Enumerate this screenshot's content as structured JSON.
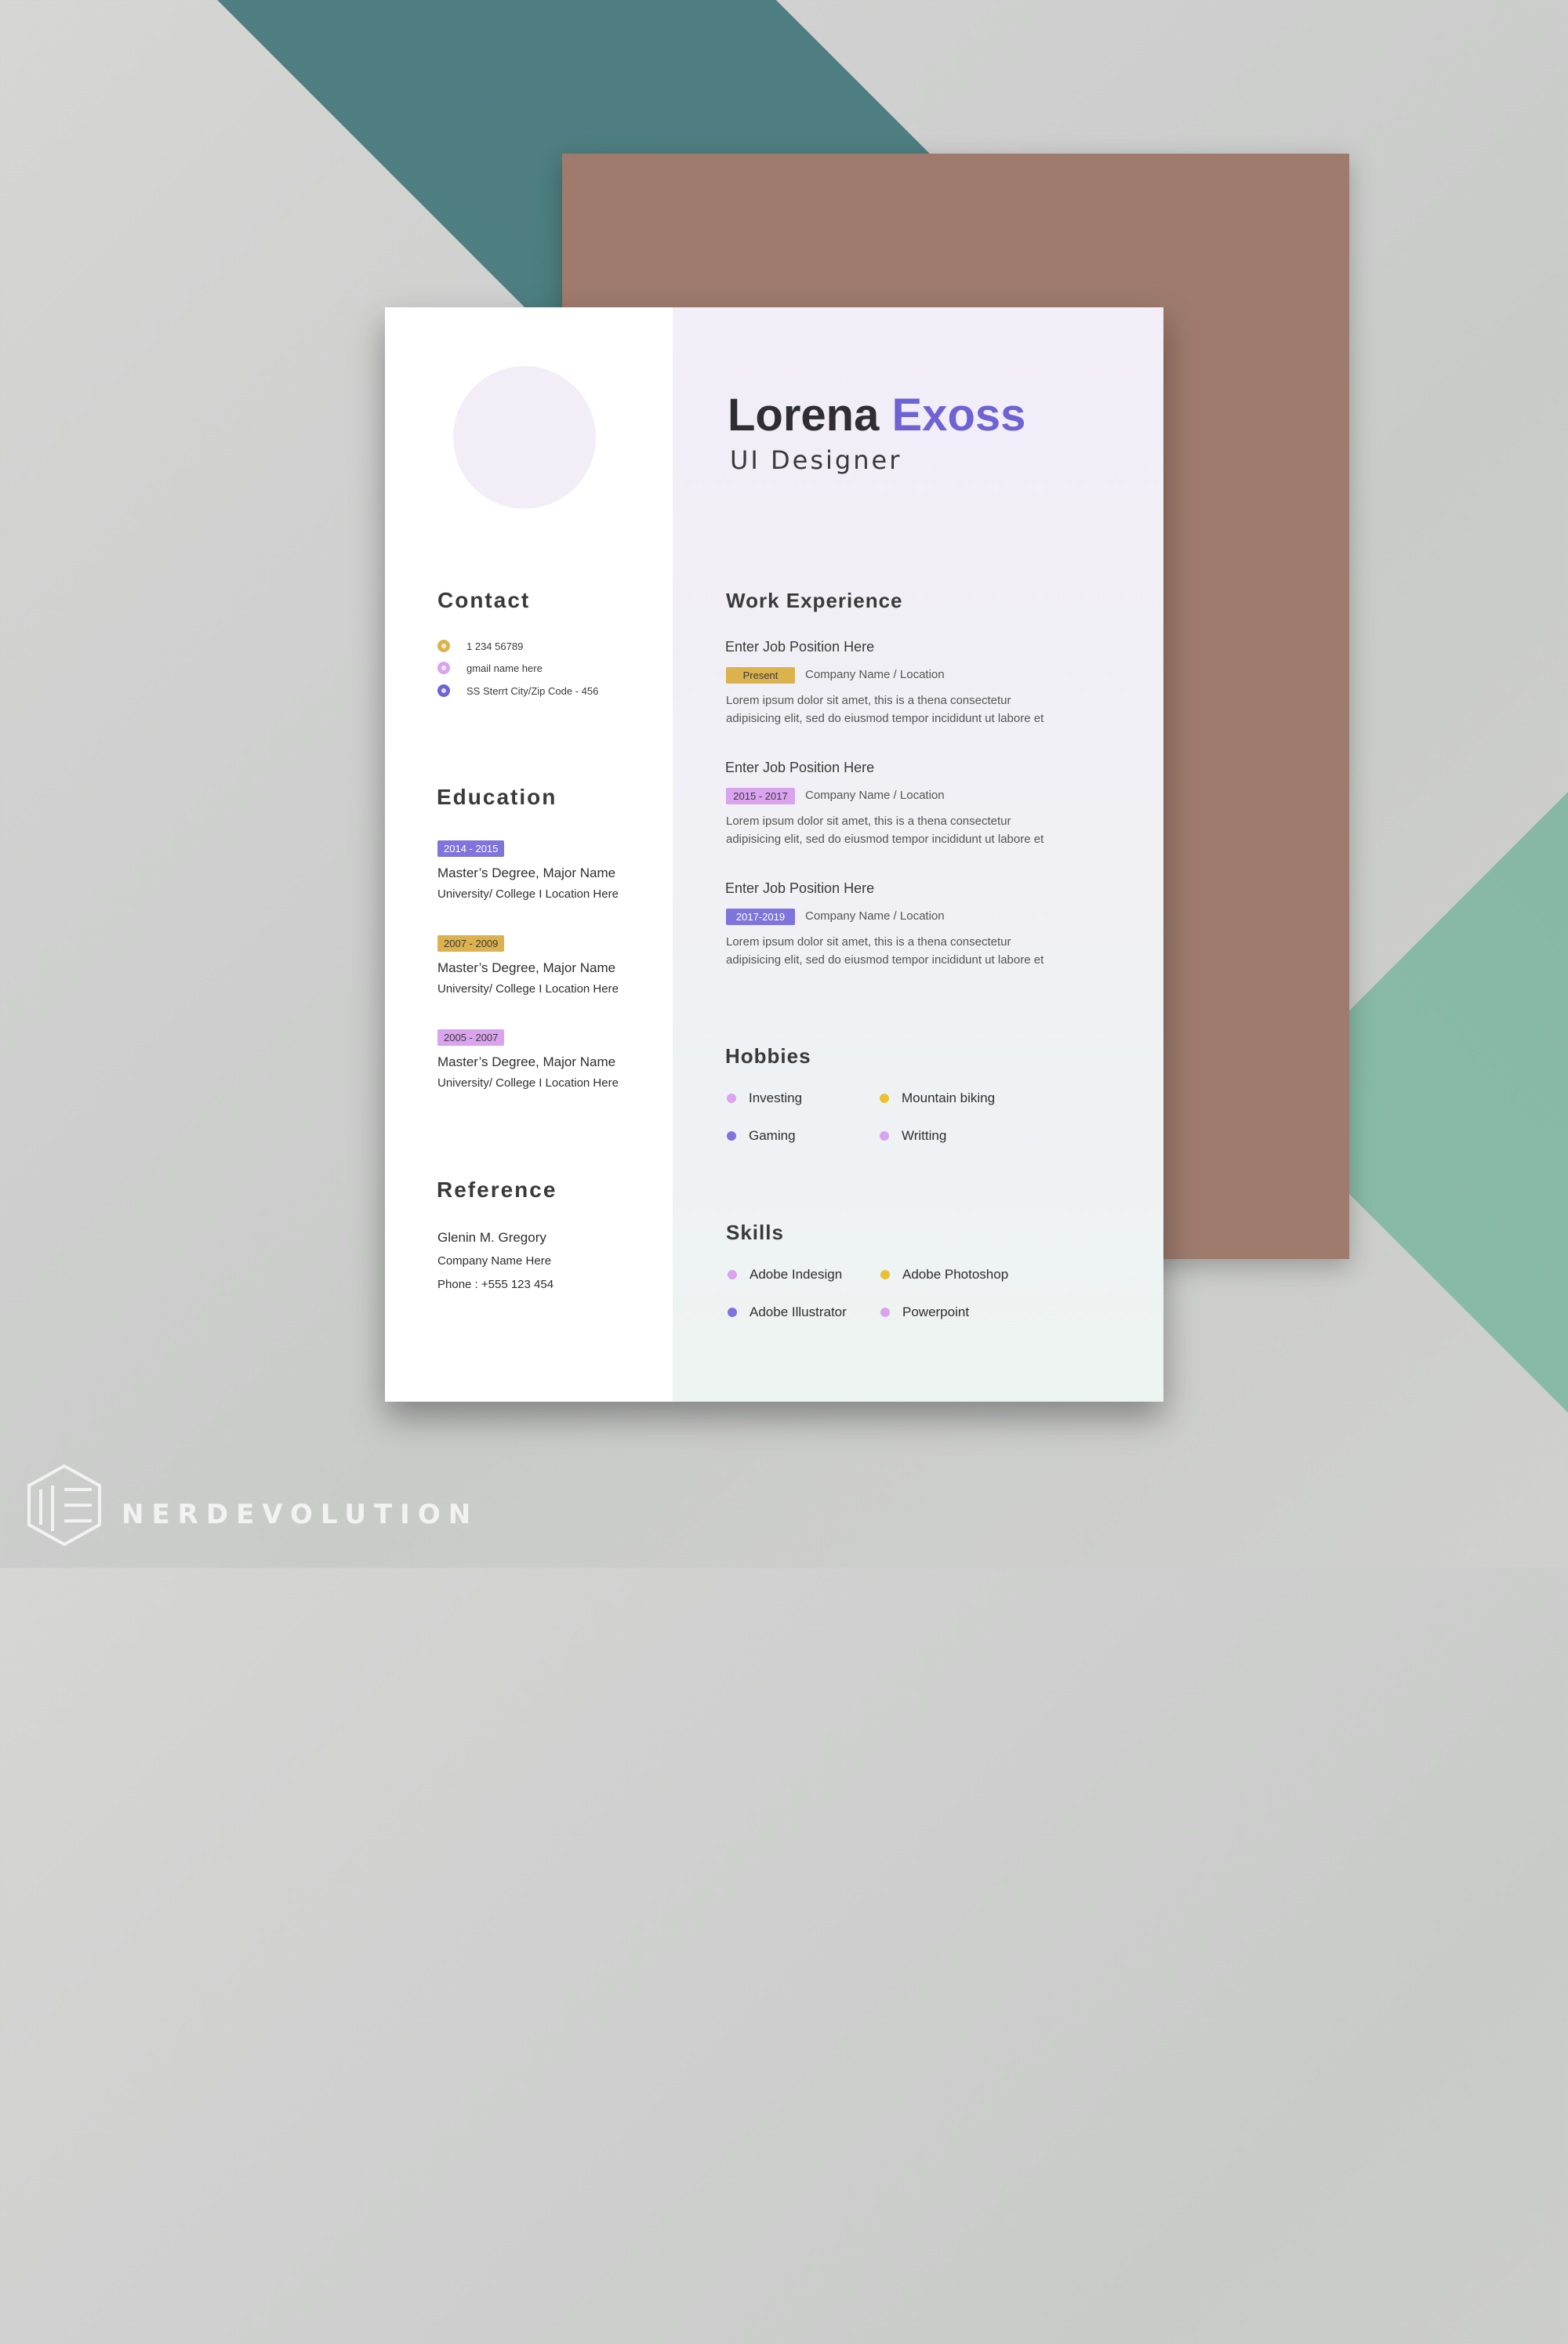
{
  "colors": {
    "accent_purple": "#6e62d4",
    "accent_gold": "#dcb24e",
    "accent_pink": "#d9a3ee",
    "brown_sheet": "#9e7b6d",
    "teal": "#4e7d82"
  },
  "header": {
    "first_name": "Lorena",
    "last_name": "Exoss",
    "role": "UI Designer"
  },
  "contact": {
    "title": "Contact",
    "items": [
      {
        "icon": "phone-icon",
        "text": "1 234 56789",
        "color": "#dcb24e"
      },
      {
        "icon": "mail-icon",
        "text": "gmail name here",
        "color": "#d9a3ee"
      },
      {
        "icon": "location-pin-icon",
        "text": "SS Sterrt City/Zip Code - 456",
        "color": "#6e62d4"
      }
    ]
  },
  "education": {
    "title": "Education",
    "items": [
      {
        "years": "2014 - 2015",
        "badge_color": "#7f74db",
        "degree": "Master’s Degree, Major Name",
        "school": "University/ College I Location Here"
      },
      {
        "years": "2007 - 2009",
        "badge_color": "#dcb24e",
        "degree": "Master’s Degree, Major Name",
        "school": "University/ College I Location Here"
      },
      {
        "years": "2005 - 2007",
        "badge_color": "#d9a3ee",
        "degree": "Master’s Degree, Major Name",
        "school": "University/ College I Location Here"
      }
    ]
  },
  "reference": {
    "title": "Reference",
    "name": "Glenin M. Gregory",
    "company": "Company Name Here",
    "phone": "Phone : +555 123 454"
  },
  "work": {
    "title": "Work Experience",
    "jobs": [
      {
        "position": "Enter Job Position Here",
        "period": "Present",
        "badge_color": "#dcb24e",
        "company": "Company Name / Location",
        "desc_1": "Lorem ipsum dolor sit amet, this is a thena  consectetur",
        "desc_2": "adipisicing elit, sed do eiusmod tempor incididunt ut labore et"
      },
      {
        "position": "Enter Job Position Here",
        "period": "2015 - 2017",
        "badge_color": "#d9a3ee",
        "company": "Company Name / Location",
        "desc_1": "Lorem ipsum dolor sit amet, this is a thena  consectetur",
        "desc_2": "adipisicing elit, sed do eiusmod tempor incididunt ut labore et"
      },
      {
        "position": "Enter Job Position Here",
        "period": "2017-2019",
        "badge_color": "#7f74db",
        "company": "Company Name / Location",
        "desc_1": "Lorem ipsum dolor sit amet, this is a thena  consectetur",
        "desc_2": "adipisicing elit, sed do eiusmod tempor incididunt ut labore et"
      }
    ]
  },
  "hobbies": {
    "title": "Hobbies",
    "items": [
      {
        "label": "Investing",
        "color": "#d9a3ee"
      },
      {
        "label": "Mountain biking",
        "color": "#e8c234"
      },
      {
        "label": "Gaming",
        "color": "#7f74db"
      },
      {
        "label": "Writting",
        "color": "#d9a3ee"
      }
    ]
  },
  "skills": {
    "title": "Skills",
    "items": [
      {
        "label": "Adobe Indesign",
        "color": "#d9a3ee"
      },
      {
        "label": "Adobe Photoshop",
        "color": "#e8c234"
      },
      {
        "label": "Adobe Illustrator",
        "color": "#7f74db"
      },
      {
        "label": "Powerpoint",
        "color": "#d9a3ee"
      }
    ]
  },
  "brand": {
    "logo_icon": "nerdevolution-logo-icon",
    "name": "NERDEVOLUTION"
  }
}
